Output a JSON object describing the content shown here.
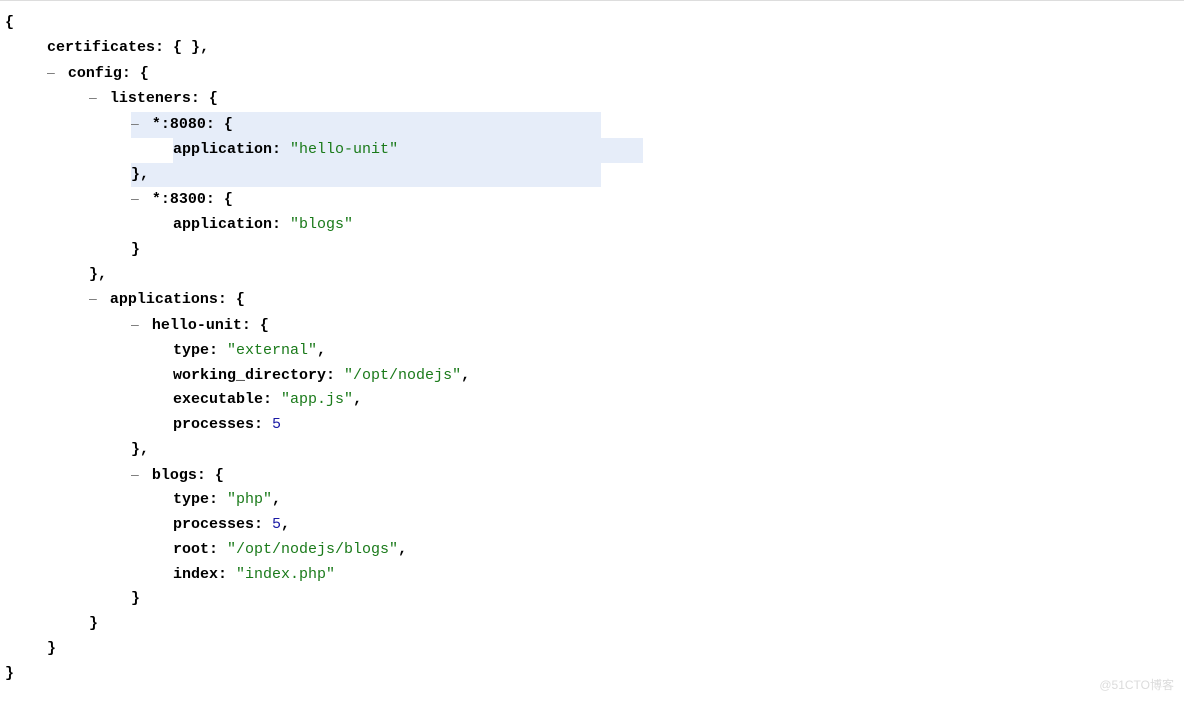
{
  "watermark": "@51CTO博客",
  "tree": {
    "open_brace": "{",
    "close_brace": "}",
    "comma": ",",
    "empty_obj": "{ }",
    "toggle_symbol": "–",
    "keys": {
      "certificates": "certificates:",
      "config": "config:",
      "listeners": "listeners:",
      "port8080": "*:8080:",
      "port8300": "*:8300:",
      "application": "application:",
      "applications": "applications:",
      "hello_unit": "hello-unit:",
      "blogs": "blogs:",
      "type": "type:",
      "working_directory": "working_directory:",
      "executable": "executable:",
      "processes": "processes:",
      "root": "root:",
      "index": "index:"
    },
    "values": {
      "hello_unit_str": "\"hello-unit\"",
      "blogs_str": "\"blogs\"",
      "external": "\"external\"",
      "opt_nodejs": "\"/opt/nodejs\"",
      "app_js": "\"app.js\"",
      "five": "5",
      "php": "\"php\"",
      "opt_nodejs_blogs": "\"/opt/nodejs/blogs\"",
      "index_php": "\"index.php\""
    }
  }
}
